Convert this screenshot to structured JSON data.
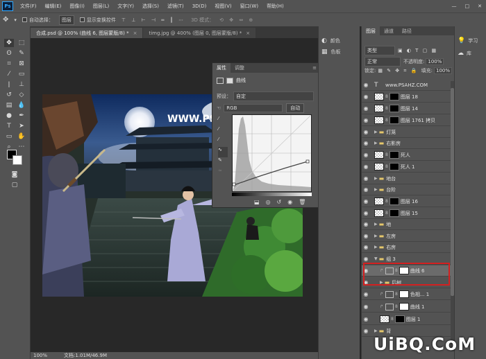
{
  "app": {
    "logo": "Ps"
  },
  "menu": [
    "文件(F)",
    "编辑(E)",
    "图像(I)",
    "图层(L)",
    "文字(Y)",
    "选择(S)",
    "滤镜(T)",
    "3D(D)",
    "视图(V)",
    "窗口(W)",
    "帮助(H)"
  ],
  "options": {
    "auto_select_label": "自动选择：",
    "auto_select_value": "图层",
    "show_transform_label": "显示变换控件",
    "mode_3d": "3D 模式："
  },
  "tabs": [
    {
      "label": "合成.psd @ 100% (曲线 6, 图层蒙版/8) *",
      "close": "×"
    },
    {
      "label": "timg.jpg @ 400% (图层 0, 图层蒙版/8) *",
      "close": "×"
    }
  ],
  "status": {
    "zoom": "100%",
    "doc": "文档:1.01M/46.9M"
  },
  "image": {
    "site_text": "WWW.PS"
  },
  "properties": {
    "tabs": [
      "属性",
      "调整"
    ],
    "title": "曲线",
    "preset_label": "预设：",
    "preset_value": "自定",
    "channel_value": "RGB",
    "auto_button": "自动"
  },
  "mini_panel": {
    "items": [
      "颜色",
      "色板"
    ]
  },
  "layers_panel": {
    "tabs": [
      "图层",
      "通道",
      "路径"
    ],
    "kind_value": "类型",
    "blend_value": "正常",
    "opacity_label": "不透明度:",
    "opacity_value": "100%",
    "lock_label": "锁定:",
    "fill_label": "填充:",
    "fill_value": "100%",
    "layers": [
      {
        "name": "www.PSAHZ.COM",
        "type": "text"
      },
      {
        "name": "图层 18",
        "type": "pixel"
      },
      {
        "name": "图层 14",
        "type": "pixel"
      },
      {
        "name": "图层 1761 拷贝",
        "type": "pixel"
      },
      {
        "name": "灯笼",
        "type": "group"
      },
      {
        "name": "右影房",
        "type": "group"
      },
      {
        "name": "死人",
        "type": "pixel"
      },
      {
        "name": "死人 1",
        "type": "pixel"
      },
      {
        "name": "地台",
        "type": "group"
      },
      {
        "name": "台阶",
        "type": "group"
      },
      {
        "name": "图层 16",
        "type": "pixel"
      },
      {
        "name": "图层 15",
        "type": "pixel"
      },
      {
        "name": "地",
        "type": "group"
      },
      {
        "name": "左房",
        "type": "group"
      },
      {
        "name": "右房",
        "type": "group"
      },
      {
        "name": "组 3",
        "type": "group-open"
      },
      {
        "name": "曲线 6",
        "type": "adjust"
      },
      {
        "name": "后树",
        "type": "group"
      },
      {
        "name": "色相... 1",
        "type": "adjust"
      },
      {
        "name": "曲线 1",
        "type": "adjust"
      },
      {
        "name": "图层 1",
        "type": "pixel"
      },
      {
        "name": "背",
        "type": "group"
      }
    ]
  },
  "far_right": {
    "items": [
      "学习",
      "库"
    ]
  },
  "watermark": "UiBQ.CoM",
  "colors": {
    "highlight": "#d42020",
    "folder": "#e5c76b"
  }
}
